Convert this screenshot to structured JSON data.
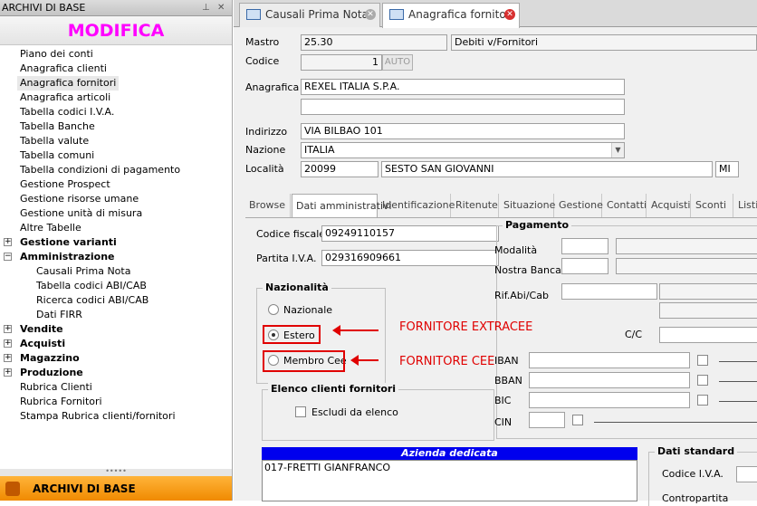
{
  "sidebar": {
    "title": "ARCHIVI DI BASE",
    "pin_icon": "pin-icon",
    "close_icon": "close-icon",
    "modifica": "MODIFICA",
    "items": [
      {
        "label": "Piano dei conti"
      },
      {
        "label": "Anagrafica clienti"
      },
      {
        "label": "Anagrafica fornitori"
      },
      {
        "label": "Anagrafica articoli"
      },
      {
        "label": "Tabella codici I.V.A."
      },
      {
        "label": "Tabella Banche"
      },
      {
        "label": "Tabella valute"
      },
      {
        "label": "Tabella comuni"
      },
      {
        "label": "Tabella condizioni di pagamento"
      },
      {
        "label": "Gestione Prospect"
      },
      {
        "label": "Gestione risorse umane"
      },
      {
        "label": "Gestione unità di misura"
      },
      {
        "label": "Altre Tabelle"
      },
      {
        "label": "Gestione varianti"
      },
      {
        "label": "Amministrazione"
      },
      {
        "label": "Causali Prima Nota"
      },
      {
        "label": "Tabella codici ABI/CAB"
      },
      {
        "label": "Ricerca codici ABI/CAB"
      },
      {
        "label": "Dati FIRR"
      },
      {
        "label": "Vendite"
      },
      {
        "label": "Acquisti"
      },
      {
        "label": "Magazzino"
      },
      {
        "label": "Produzione"
      },
      {
        "label": "Rubrica Clienti"
      },
      {
        "label": "Rubrica Fornitori"
      },
      {
        "label": "Stampa Rubrica clienti/fornitori"
      }
    ],
    "footer": "ARCHIVI DI BASE"
  },
  "tabs": [
    {
      "label": "Causali Prima Nota"
    },
    {
      "label": "Anagrafica fornitori"
    }
  ],
  "form": {
    "mastro_label": "Mastro",
    "mastro_value": "25.30",
    "mastro_desc": "Debiti v/Fornitori",
    "codice_label": "Codice",
    "codice_value": "1",
    "auto_label": "AUTO",
    "anagrafica_label": "Anagrafica",
    "anagrafica_value": "REXEL ITALIA S.P.A.",
    "anagrafica_value2": "",
    "indirizzo_label": "Indirizzo",
    "indirizzo_value": "VIA BILBAO 101",
    "nazione_label": "Nazione",
    "nazione_value": "ITALIA",
    "localita_label": "Località",
    "cap_value": "20099",
    "citta_value": "SESTO SAN GIOVANNI",
    "prov_value": "MI"
  },
  "inner_tabs": [
    {
      "label": "Browse"
    },
    {
      "label": "Dati amministrativi"
    },
    {
      "label": "Identificazione"
    },
    {
      "label": "Ritenute"
    },
    {
      "label": "Situazione"
    },
    {
      "label": "Gestione"
    },
    {
      "label": "Contatti"
    },
    {
      "label": "Acquisti"
    },
    {
      "label": "Sconti"
    },
    {
      "label": "Listini"
    }
  ],
  "admin": {
    "cf_label": "Codice fiscale",
    "cf_value": "09249110157",
    "piva_label": "Partita I.V.A.",
    "piva_value": "029316909661",
    "nazionalita_title": "Nazionalità",
    "radio_nazionale": "Nazionale",
    "radio_estero": "Estero",
    "radio_membro": "Membro Cee",
    "elenco_title": "Elenco clienti fornitori",
    "escludi_label": "Escludi da elenco",
    "pagamento_title": "Pagamento",
    "modalita_label": "Modalità",
    "nostra_banca_label": "Nostra Banca",
    "rif_label": "Rif.Abi/Cab",
    "cc_label": "C/C",
    "iban_label": "IBAN",
    "bban_label": "BBAN",
    "bic_label": "BIC",
    "cin_label": "CIN",
    "azienda_title": "Azienda dedicata",
    "azienda_row": "017-FRETTI GIANFRANCO",
    "dati_standard_title": "Dati standard",
    "codice_iva_label": "Codice I.V.A.",
    "contropartita_label": "Contropartita"
  },
  "annotations": {
    "extracee": "FORNITORE EXTRACEE",
    "cee": "FORNITORE CEE"
  },
  "colors": {
    "annotation": "#e00000",
    "modifica": "#ff00ff",
    "footer": "#f59a10",
    "accent_blue": "#0000ee"
  }
}
